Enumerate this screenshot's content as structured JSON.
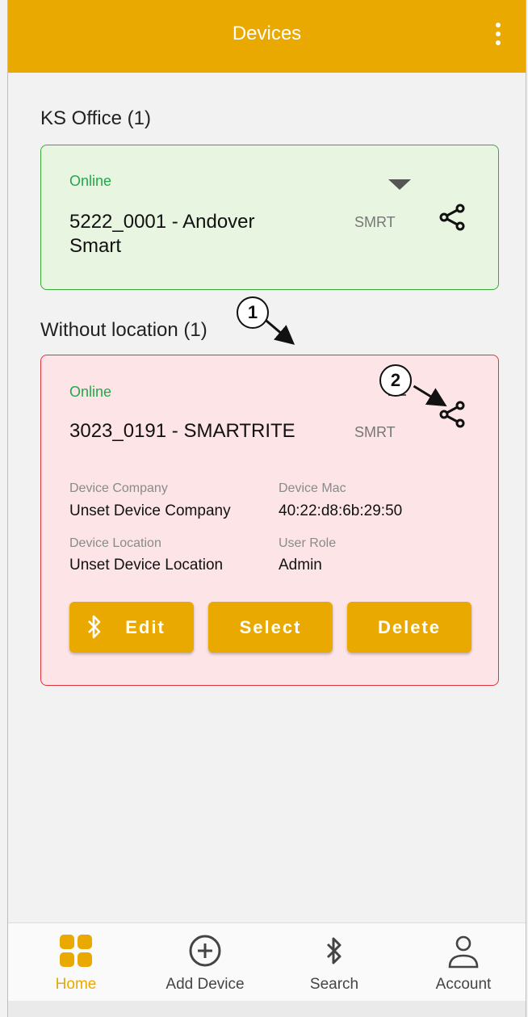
{
  "appbar": {
    "title": "Devices",
    "menu_icon": "more-vertical-icon"
  },
  "groups": [
    {
      "title": "KS Office (1)",
      "device": {
        "status": "Online",
        "name": "5222_0001 - Andover Smart",
        "name_line1": "5222_0001 - Andover",
        "name_line2": "Smart",
        "model": "SMRT"
      }
    },
    {
      "title": "Without location (1)",
      "device": {
        "status": "Online",
        "name": "3023_0191 - SMARTRITE",
        "model": "SMRT",
        "details": {
          "company_label": "Device Company",
          "company_value": "Unset Device Company",
          "mac_label": "Device Mac",
          "mac_value": "40:22:d8:6b:29:50",
          "location_label": "Device Location",
          "location_value": "Unset Device Location",
          "role_label": "User Role",
          "role_value": "Admin"
        },
        "buttons": {
          "edit": "Edit",
          "select": "Select",
          "delete": "Delete"
        }
      }
    }
  ],
  "annotations": {
    "first": "1",
    "second": "2"
  },
  "bottom_nav": [
    {
      "label": "Home",
      "icon": "grid-icon",
      "active": true
    },
    {
      "label": "Add Device",
      "icon": "add-circle-icon",
      "active": false
    },
    {
      "label": "Search",
      "icon": "bluetooth-icon",
      "active": false
    },
    {
      "label": "Account",
      "icon": "person-icon",
      "active": false
    }
  ],
  "colors": {
    "accent": "#e9a900",
    "online": "#22a84a",
    "green_card": "#e8f5e1",
    "red_card": "#fde4e6"
  }
}
